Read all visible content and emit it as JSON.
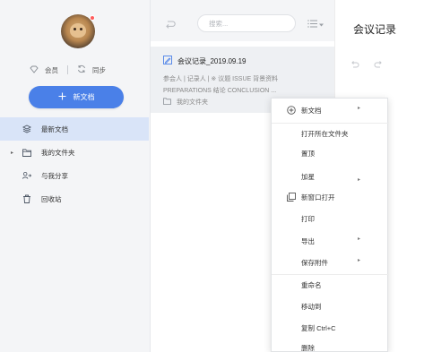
{
  "sidebar": {
    "member_label": "会员",
    "sync_label": "同步",
    "new_doc_label": "新文档",
    "items": [
      {
        "label": "最新文档",
        "active": true
      },
      {
        "label": "我的文件夹",
        "active": false
      },
      {
        "label": "与我分享",
        "active": false
      },
      {
        "label": "回收站",
        "active": false
      }
    ]
  },
  "list": {
    "search_placeholder": "搜索...",
    "note": {
      "title": "会议记录_2019.09.19",
      "meta_line1": "参会人 | 记录人 | ※ 议题 ISSUE 背景资料",
      "meta_line2": "PREPARATIONS 结论 CONCLUSION ...",
      "folder": "我的文件夹"
    }
  },
  "editor": {
    "title": "会议记录"
  },
  "context_menu": {
    "items": [
      {
        "label": "新文档",
        "icon": "plus-circle-icon",
        "submenu": true
      },
      {
        "label": "打开所在文件夹",
        "submenu": false
      },
      {
        "label": "置顶",
        "submenu": false
      },
      {
        "label": "加星",
        "submenu": true
      },
      {
        "label": "新窗口打开",
        "icon": "new-window-icon",
        "submenu": false
      },
      {
        "label": "打印",
        "submenu": false
      },
      {
        "label": "导出",
        "submenu": true
      },
      {
        "label": "保存附件",
        "submenu": true
      },
      {
        "label": "重命名",
        "submenu": false
      },
      {
        "label": "移动到",
        "submenu": false
      },
      {
        "label": "复制 Ctrl+C",
        "submenu": false
      },
      {
        "label": "删除",
        "submenu": false
      }
    ]
  },
  "colors": {
    "accent": "#4a80e8",
    "active_bg": "#d9e4f8",
    "sidebar_bg": "#f4f5f7"
  }
}
